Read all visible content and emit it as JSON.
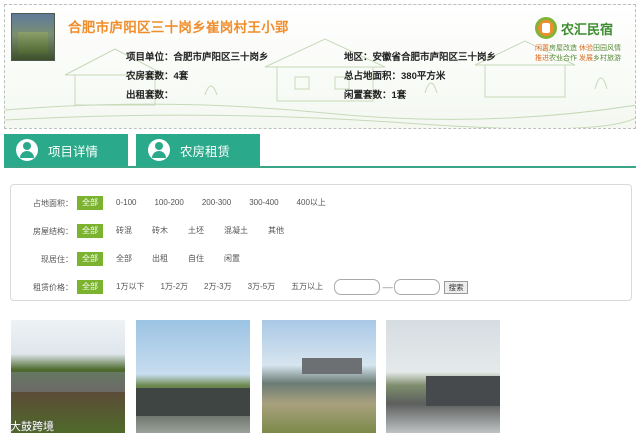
{
  "header": {
    "title": "合肥市庐阳区三十岗乡崔岗村王小郢",
    "info": {
      "unit": "项目单位：合肥市庐阳区三十岗乡",
      "region": "地区：安徽省合肥市庐阳区三十岗乡",
      "houses": "农房套数：4套",
      "area": "总占地面积：380平方米",
      "rented": "出租套数：",
      "idle": "闲置套数：1套"
    },
    "logo": {
      "name": "农汇民宿",
      "sub1a": "闲置",
      "sub1b": "房屋改造",
      "sub1c": "休验",
      "sub1d": "田园风情",
      "sub2a": "推进",
      "sub2b": "农业合作",
      "sub2c": "发展",
      "sub2d": "乡村旅游"
    }
  },
  "tabs": [
    {
      "label": "项目详情"
    },
    {
      "label": "农房租赁"
    }
  ],
  "filters": {
    "area": {
      "label": "占地面积：",
      "options": [
        "全部",
        "0-100",
        "100-200",
        "200-300",
        "300-400",
        "400以上"
      ]
    },
    "structure": {
      "label": "房屋结构：",
      "options": [
        "全部",
        "砖混",
        "砖木",
        "土坯",
        "混凝土",
        "其他"
      ]
    },
    "status": {
      "label": "现居住：",
      "options": [
        "全部",
        "全部",
        "出租",
        "自住",
        "闲置"
      ]
    },
    "price": {
      "label": "租赁价格：",
      "options": [
        "全部",
        "1万以下",
        "1万-2万",
        "2万-3万",
        "3万-5万",
        "五万以上"
      ],
      "dash": "------",
      "search_label": "搜索"
    }
  },
  "watermark": "大鼓跨境",
  "colors": {
    "title": "#f08d2c",
    "tab": "#2aaa8a",
    "selected": "#7bb32e"
  }
}
